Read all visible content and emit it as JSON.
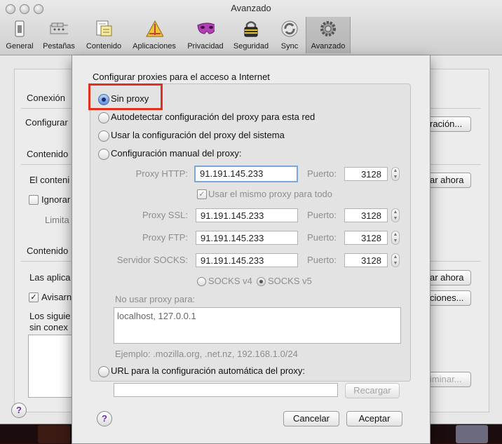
{
  "window": {
    "title": "Avanzado"
  },
  "toolbar": [
    {
      "label": "General",
      "icon": "general-switch-icon"
    },
    {
      "label": "Pestañas",
      "icon": "tabs-icon"
    },
    {
      "label": "Contenido",
      "icon": "content-document-icon"
    },
    {
      "label": "Aplicaciones",
      "icon": "applications-icon"
    },
    {
      "label": "Privacidad",
      "icon": "privacy-mask-icon"
    },
    {
      "label": "Seguridad",
      "icon": "security-lock-icon"
    },
    {
      "label": "Sync",
      "icon": "sync-icon"
    },
    {
      "label": "Avanzado",
      "icon": "advanced-gear-icon"
    }
  ],
  "background": {
    "conexion_heading": "Conexión",
    "configurar_label": "Configurar",
    "config_button": "ración...",
    "contenido_heading_1": "Contenido",
    "el_contenido": "El conteni",
    "limpiar_button_1": "ar ahora",
    "ignorar": "Ignorar",
    "limita": "Limita",
    "contenido_heading_2": "Contenido",
    "las_aplicaciones": "Las aplica",
    "limpiar_button_2": "ar ahora",
    "avisarme": "Avisarn",
    "excepciones_button": "ciones...",
    "los_siguientes": "Los siguie",
    "sin_conexion": "sin conex",
    "eliminar_button": "iminar..."
  },
  "dialog": {
    "title": "Configurar proxies para el acceso a Internet",
    "options": {
      "sin_proxy": "Sin proxy",
      "autodetectar": "Autodetectar configuración del proxy para esta red",
      "sistema": "Usar la configuración del proxy del sistema",
      "manual": "Configuración manual del proxy:",
      "url": "URL para la configuración automática del proxy:"
    },
    "http": {
      "label": "Proxy HTTP:",
      "value": "91.191.145.233",
      "port_label": "Puerto:",
      "port": "3128"
    },
    "same_proxy": "Usar el mismo proxy para todo",
    "ssl": {
      "label": "Proxy SSL:",
      "value": "91.191.145.233",
      "port_label": "Puerto:",
      "port": "3128"
    },
    "ftp": {
      "label": "Proxy FTP:",
      "value": "91.191.145.233",
      "port_label": "Puerto:",
      "port": "3128"
    },
    "socks": {
      "label": "Servidor SOCKS:",
      "value": "91.191.145.233",
      "port_label": "Puerto:",
      "port": "3128"
    },
    "socks_v4": "SOCKS v4",
    "socks_v5": "SOCKS v5",
    "no_proxy_label": "No usar proxy para:",
    "no_proxy_value": "localhost, 127.0.0.1",
    "example": "Ejemplo: .mozilla.org, .net.nz, 192.168.1.0/24",
    "reload": "Recargar",
    "cancel": "Cancelar",
    "accept": "Aceptar",
    "help": "?"
  },
  "colors": {
    "highlight": "#e0301f",
    "selected_radio": "#5c8fd9"
  }
}
